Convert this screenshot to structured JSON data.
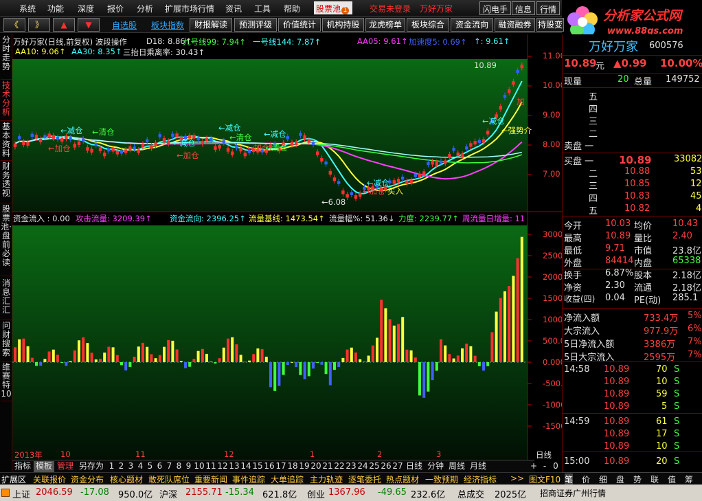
{
  "menu": {
    "items": [
      "系统",
      "功能",
      "深度",
      "报价",
      "分析",
      "扩展市场行情",
      "资讯",
      "工具",
      "帮助"
    ],
    "pool_label": "股票池",
    "pool_count": "1",
    "login": "交易未登录",
    "stock_link": "万好万家",
    "right_btns": [
      "闪电手",
      "信息",
      "行情"
    ]
  },
  "logo": {
    "text": "分析家公式网",
    "url": "www.88gs.com"
  },
  "toolbar": {
    "nav": [
      "《",
      "》",
      "▲",
      "▼"
    ],
    "links": [
      "自选股",
      "板块指数"
    ],
    "buttons": [
      "财报解读",
      "预测评级",
      "价值统计",
      "机构持股",
      "龙虎榜单",
      "板块综合",
      "资金流向",
      "融资融券",
      "持股变"
    ]
  },
  "sidetabs": [
    "分时走势",
    "技术分析",
    "基本资料",
    "财务透视",
    "股票池·盘前必读",
    "消息汇汇",
    "问财搜索",
    "维赛特10"
  ],
  "price_panel": {
    "line1": [
      {
        "t": "万好万家(日线,前复权) 波段操作",
        "c": "#e0e0e0"
      },
      {
        "t": "D18: 8.86↑",
        "c": "#e0e0e0"
      },
      {
        "t": "九号线99: 7.94↑",
        "c": "#40ff40"
      },
      {
        "t": "一号线144: 7.87↑",
        "c": "#40ffff"
      },
      {
        "t": "AA05: 9.61↑",
        "c": "#ff40ff"
      },
      {
        "t": "加速度5: 0.69↑",
        "c": "#4060ff"
      },
      {
        "t": "↑: 9.61↑",
        "c": "#40ffff"
      }
    ],
    "line2": [
      {
        "t": "AA10: 9.06↑",
        "c": "#ffff40"
      },
      {
        "t": "AA30: 8.35↑",
        "c": "#40ffff"
      },
      {
        "t": "三抬日乘离率: 30.43↑",
        "c": "#e0e0e0"
      }
    ],
    "annotations": [
      {
        "t": "←减仓",
        "c": "#40ffff"
      },
      {
        "t": "←清仓",
        "c": "#40ff40"
      },
      {
        "t": "←加仓",
        "c": "#ff4040"
      },
      {
        "t": "←减仓",
        "c": "#40ffff"
      },
      {
        "t": "←加仓",
        "c": "#ff4040"
      },
      {
        "t": "←减仓",
        "c": "#40ffff"
      },
      {
        "t": "←清仓",
        "c": "#40ff40"
      },
      {
        "t": "←减仓",
        "c": "#40ffff"
      },
      {
        "t": "←加仓",
        "c": "#ff4040"
      },
      {
        "t": "←清仓",
        "c": "#40ff40"
      },
      {
        "t": "←加仓",
        "c": "#ff4040"
      },
      {
        "t": "←减仓",
        "c": "#40ffff"
      },
      {
        "t": "买入",
        "c": "#ffff40"
      },
      {
        "t": "←减仓",
        "c": "#40ffff"
      },
      {
        "t": "←强势介",
        "c": "#ffff40"
      },
      {
        "t": "←6.08",
        "c": "#e0e0e0"
      },
      {
        "t": "10.89",
        "c": "#e0e0e0"
      },
      {
        "t": "加",
        "c": "#ff4040"
      }
    ],
    "yticks": [
      "11.00",
      "10.00",
      "9.00",
      "8.00",
      "7.00"
    ]
  },
  "flow_panel": {
    "header": [
      {
        "t": "资金流入 : 0.00",
        "c": "#e0e0e0"
      },
      {
        "t": "攻击流量: 3209.39↑",
        "c": "#ff40ff"
      },
      {
        "t": "资金流向: 2396.25↑",
        "c": "#40ffff"
      },
      {
        "t": "流量基线: 1473.54↑",
        "c": "#ffff40"
      },
      {
        "t": "流量幅%: 51.36↓",
        "c": "#e0e0e0"
      },
      {
        "t": "力度: 2239.77↑",
        "c": "#40ff40"
      },
      {
        "t": "周流量日增量: 11",
        "c": "#ff40ff"
      }
    ],
    "yticks": [
      "3000",
      "2500",
      "2000",
      "1500",
      "1000",
      "500.0",
      "0.000",
      "-500.0",
      "-1000",
      "-1500"
    ]
  },
  "xaxis": {
    "labels": [
      "2013年",
      "10",
      "11",
      "12",
      "1",
      "2",
      "3"
    ],
    "right": "日线"
  },
  "bottomtabs": {
    "items": [
      "指标",
      "模板",
      "管理",
      "另存为",
      "1",
      "2",
      "3",
      "4",
      "5",
      "6",
      "7",
      "8",
      "9",
      "10",
      "11",
      "12",
      "13",
      "14",
      "15",
      "16",
      "17",
      "18",
      "19",
      "20",
      "21",
      "22",
      "23",
      "24",
      "25",
      "26",
      "27",
      "日线",
      "分钟",
      "周线",
      "月线"
    ],
    "right": [
      "+",
      "-",
      "0"
    ]
  },
  "subbar": {
    "items": [
      "扩展区",
      "关联报价",
      "资金分布",
      "核心题材",
      "敢死队席位",
      "重要新闻",
      "事件追踪",
      "大单追踪",
      "主力轨迹",
      "逐笔委托",
      "热点题材",
      "一致预期",
      "经济指标",
      ">>",
      "图文F10"
    ]
  },
  "rbottom": {
    "items": [
      "笔",
      "价",
      "细",
      "盘",
      "势",
      "联",
      "值",
      "筹"
    ]
  },
  "stock": {
    "name": "万好万家",
    "code": "600576",
    "price": "10.89",
    "unit": "元",
    "change": "▲0.99",
    "pct": "10.00%",
    "now_label": "现量",
    "now_val": "20",
    "total_label": "总量",
    "total_val": "149752",
    "sell_labels": [
      "五",
      "四",
      "三",
      "二",
      "卖盘 一"
    ],
    "buy": [
      {
        "l": "买盘 一",
        "p": "10.89",
        "v": "33082"
      },
      {
        "l": "二",
        "p": "10.88",
        "v": "53"
      },
      {
        "l": "三",
        "p": "10.85",
        "v": "12"
      },
      {
        "l": "四",
        "p": "10.83",
        "v": "45"
      },
      {
        "l": "五",
        "p": "10.82",
        "v": "4"
      }
    ],
    "stats": [
      [
        {
          "t": "今开",
          "c": "#e0e0e0"
        },
        {
          "t": "10.03",
          "c": "#ff4040"
        },
        {
          "t": "均价",
          "c": "#e0e0e0"
        },
        {
          "t": "10.43",
          "c": "#ff4040"
        }
      ],
      [
        {
          "t": "最高",
          "c": "#e0e0e0"
        },
        {
          "t": "10.89",
          "c": "#ff4040"
        },
        {
          "t": "量比",
          "c": "#e0e0e0"
        },
        {
          "t": "2.40",
          "c": "#ff4040"
        }
      ],
      [
        {
          "t": "最低",
          "c": "#e0e0e0"
        },
        {
          "t": "9.71",
          "c": "#ff4040"
        },
        {
          "t": "市值",
          "c": "#e0e0e0"
        },
        {
          "t": "23.8亿",
          "c": "#e0e0e0"
        }
      ],
      [
        {
          "t": "外盘",
          "c": "#e0e0e0"
        },
        {
          "t": "84414",
          "c": "#ff4040"
        },
        {
          "t": "内盘",
          "c": "#e0e0e0"
        },
        {
          "t": "65338",
          "c": "#40ff40"
        }
      ],
      [
        {
          "t": "换手",
          "c": "#e0e0e0"
        },
        {
          "t": "6.87%",
          "c": "#e0e0e0"
        },
        {
          "t": "股本",
          "c": "#e0e0e0"
        },
        {
          "t": "2.18亿",
          "c": "#e0e0e0"
        }
      ],
      [
        {
          "t": "净资",
          "c": "#e0e0e0"
        },
        {
          "t": "2.30",
          "c": "#e0e0e0"
        },
        {
          "t": "流通",
          "c": "#e0e0e0"
        },
        {
          "t": "2.18亿",
          "c": "#e0e0e0"
        }
      ],
      [
        {
          "t": "收益(四)",
          "c": "#e0e0e0"
        },
        {
          "t": "0.04",
          "c": "#e0e0e0"
        },
        {
          "t": "PE(动)",
          "c": "#e0e0e0"
        },
        {
          "t": "285.1",
          "c": "#e0e0e0"
        }
      ]
    ],
    "flows": [
      {
        "l": "净流入额",
        "v": "733.4万",
        "p": "5%"
      },
      {
        "l": "大宗流入",
        "v": "977.9万",
        "p": "6%"
      },
      {
        "l": "5日净流入额",
        "v": "3386万",
        "p": "7%"
      },
      {
        "l": "5日大宗流入",
        "v": "2595万",
        "p": "7%"
      }
    ],
    "ticks": [
      {
        "time": "14:58",
        "price": "10.89",
        "vol": "70",
        "bs": "S"
      },
      {
        "time": "",
        "price": "10.89",
        "vol": "10",
        "bs": "S"
      },
      {
        "time": "",
        "price": "10.89",
        "vol": "59",
        "bs": "S"
      },
      {
        "time": "",
        "price": "10.89",
        "vol": "5",
        "bs": "S"
      },
      {
        "time": "14:59",
        "price": "10.89",
        "vol": "61",
        "bs": "S"
      },
      {
        "time": "",
        "price": "10.89",
        "vol": "17",
        "bs": "S"
      },
      {
        "time": "",
        "price": "10.89",
        "vol": "10",
        "bs": "S"
      },
      {
        "time": "15:00",
        "price": "10.89",
        "vol": "20",
        "bs": "S"
      }
    ]
  },
  "status": {
    "items": [
      {
        "t": "上证",
        "c": "#000"
      },
      {
        "t": "2046.59",
        "c": "#c00000"
      },
      {
        "t": "-17.08",
        "c": "#008000"
      },
      {
        "t": "950.0亿",
        "c": "#000"
      },
      {
        "t": "沪深",
        "c": "#000"
      },
      {
        "t": "2155.71",
        "c": "#c00000"
      },
      {
        "t": "-15.34",
        "c": "#008000"
      },
      {
        "t": "621.8亿",
        "c": "#000"
      },
      {
        "t": "创业",
        "c": "#000"
      },
      {
        "t": "1367.96",
        "c": "#c00000"
      },
      {
        "t": "-49.65",
        "c": "#008000"
      },
      {
        "t": "232.6亿",
        "c": "#000"
      },
      {
        "t": "总成交",
        "c": "#000"
      },
      {
        "t": "2025亿",
        "c": "#000"
      },
      {
        "t": "招商证券广州行情",
        "c": "#000"
      }
    ]
  }
}
